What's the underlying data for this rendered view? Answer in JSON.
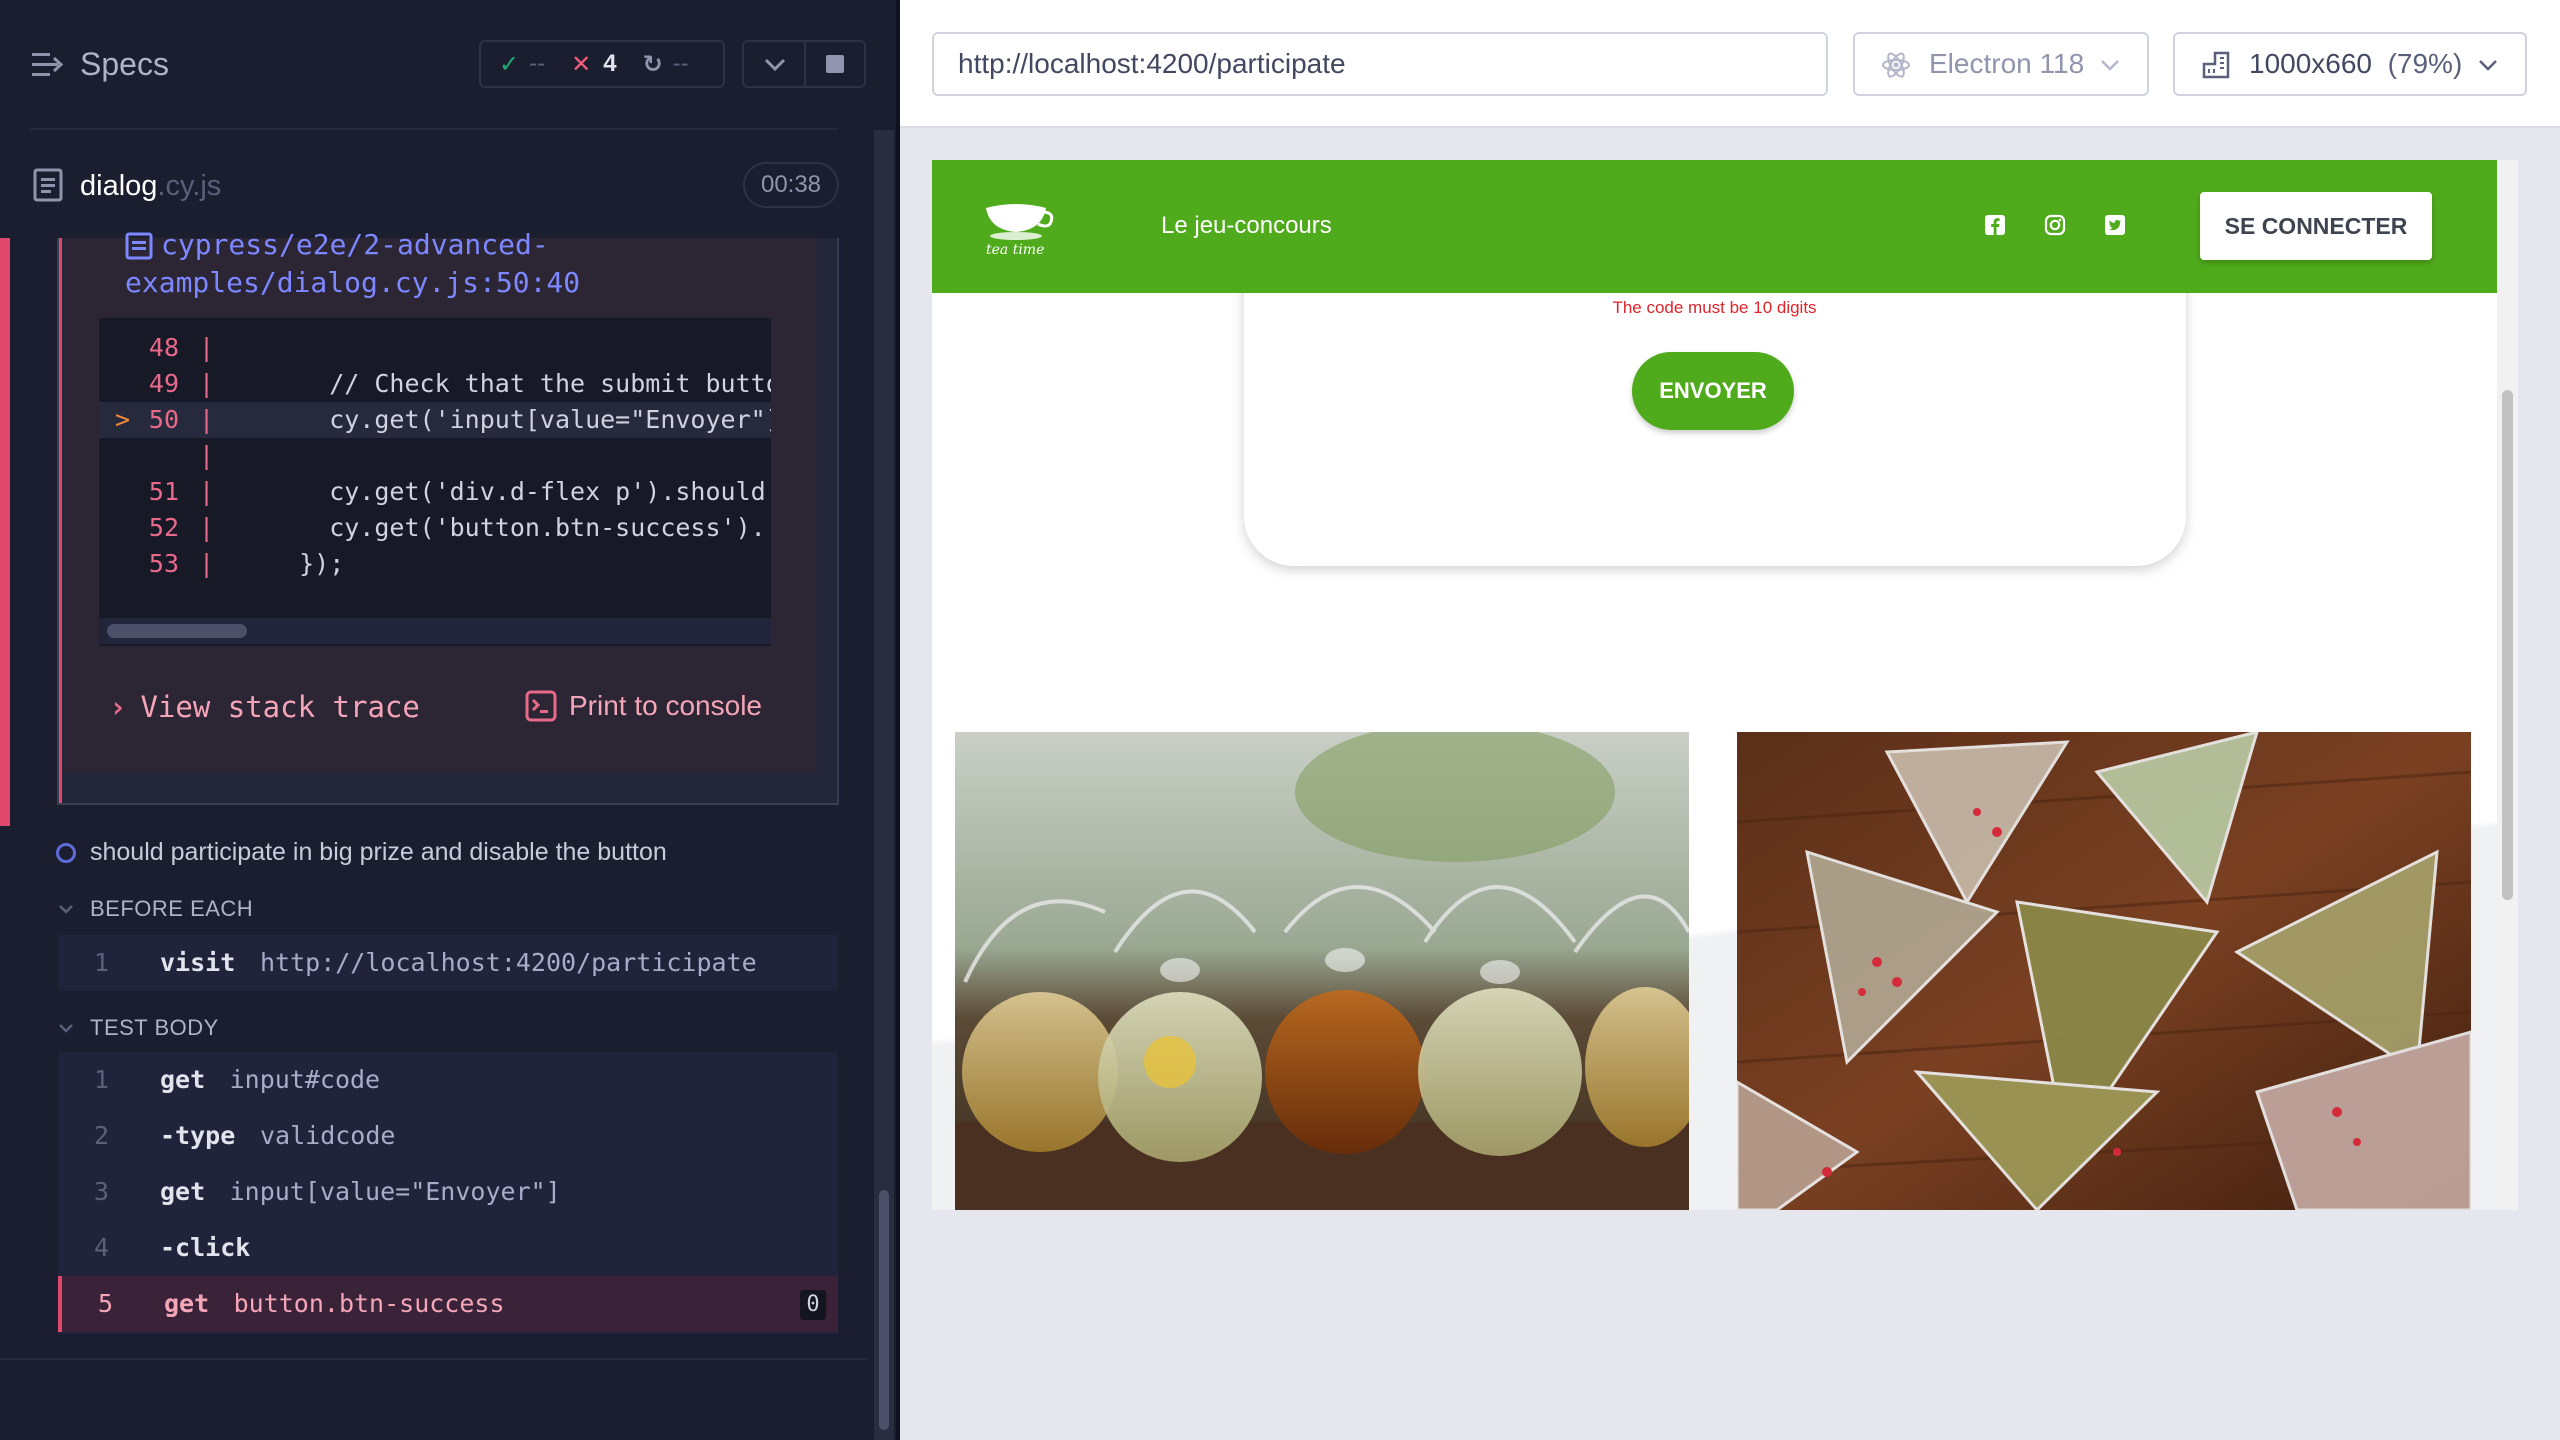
{
  "runner": {
    "specs_label": "Specs",
    "stats": {
      "passed": "--",
      "failed": "4",
      "pending": "--"
    },
    "file": {
      "name": "dialog",
      "ext": ".cy.js",
      "time": "00:38"
    },
    "error": {
      "code_path": "cypress/e2e/2-advanced-examples/dialog.cy.js:50:40",
      "code_lines": [
        {
          "num": "48",
          "code": ""
        },
        {
          "num": "49",
          "code": "    // Check that the submit butto"
        },
        {
          "num": "50",
          "code": "    cy.get('input[value=\"Envoyer\"]",
          "highlight": true
        },
        {
          "num": "",
          "code": ""
        },
        {
          "num": "51",
          "code": "    cy.get('div.d-flex p').should"
        },
        {
          "num": "52",
          "code": "    cy.get('button.btn-success')."
        },
        {
          "num": "53",
          "code": "  });"
        }
      ],
      "view_stack": "View stack trace",
      "print_console": "Print to console"
    },
    "test2_title": "should participate in big prize and disable the button",
    "before_each": {
      "label": "BEFORE EACH",
      "commands": [
        {
          "num": "1",
          "name": "visit",
          "msg": "http://localhost:4200/participate"
        }
      ]
    },
    "test_body": {
      "label": "TEST BODY",
      "commands": [
        {
          "num": "1",
          "name": "get",
          "msg": "input#code"
        },
        {
          "num": "2",
          "name": "-type",
          "msg": "validcode"
        },
        {
          "num": "3",
          "name": "get",
          "msg": "input[value=\"Envoyer\"]"
        },
        {
          "num": "4",
          "name": "-click",
          "msg": ""
        },
        {
          "num": "5",
          "name": "get",
          "msg": "button.btn-success",
          "count": "0",
          "active": true
        }
      ]
    }
  },
  "browser": {
    "url": "http://localhost:4200/participate",
    "browser_name": "Electron 118",
    "viewport": "1000x660",
    "zoom": "(79%)"
  },
  "aut": {
    "logo_text": "tea time",
    "nav_link": "Le jeu-concours",
    "social_icons": [
      "facebook-icon",
      "instagram-icon",
      "twitter-icon"
    ],
    "login_button": "SE CONNECTER",
    "error_message": "The code must be 10 digits",
    "send_button": "ENVOYER"
  },
  "colors": {
    "brand_green": "#4fab1b",
    "error_red": "#e0242b",
    "fail_pink": "#e0476c",
    "runner_bg": "#1b1e2e"
  }
}
